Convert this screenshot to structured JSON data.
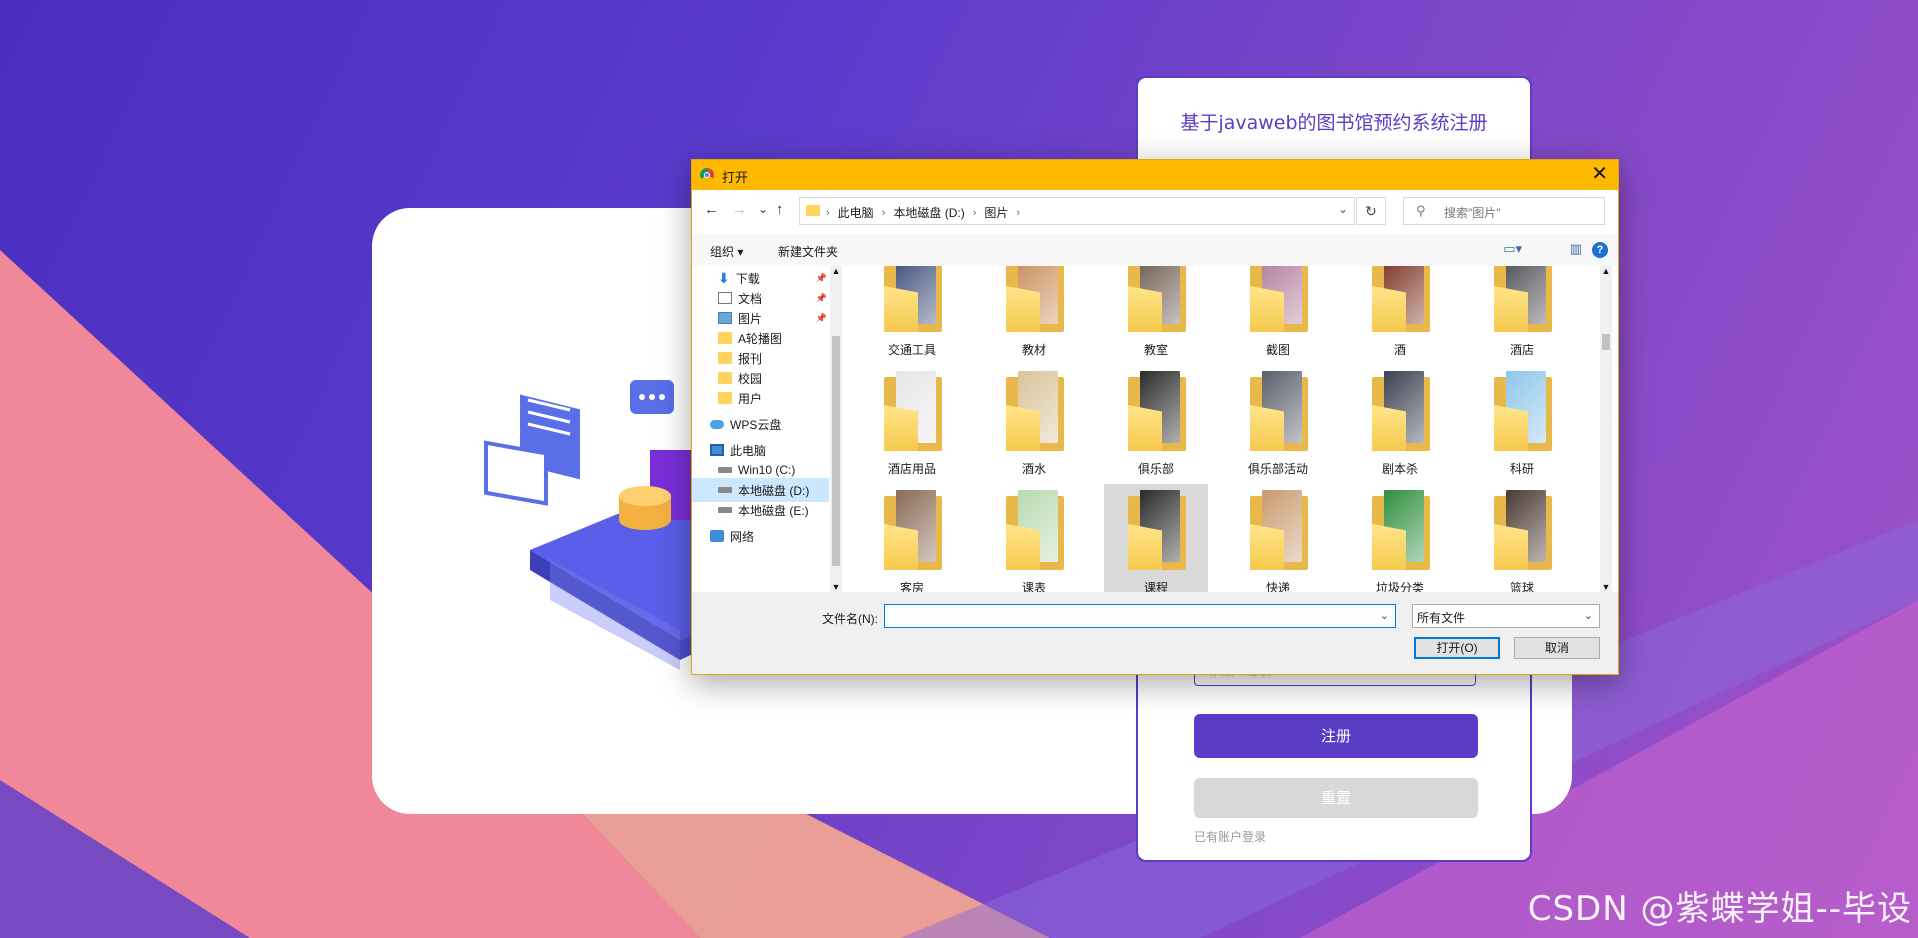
{
  "background": {
    "colors": {
      "purple": "#5a3bcc",
      "pink": "#f0889a",
      "peach": "#f7a98f",
      "accent": "#5b3cc4"
    }
  },
  "registration": {
    "title": "基于javaweb的图书馆预约系统注册",
    "field_placeholder": "请输入班级",
    "submit_label": "注册",
    "reset_label": "重置",
    "login_link": "已有账户登录"
  },
  "dialog": {
    "title": "打开",
    "close": "✕",
    "nav": {
      "back": "←",
      "forward": "→",
      "recent": "⌄",
      "up": "↑",
      "refresh": "↻"
    },
    "breadcrumb": [
      "此电脑",
      "本地磁盘 (D:)",
      "图片"
    ],
    "search_placeholder": "搜索\"图片\"",
    "commands": {
      "organize": "组织 ▾",
      "new_folder": "新建文件夹"
    },
    "nav_items": [
      {
        "label": "下载",
        "icon": "download-icon",
        "pinned": true
      },
      {
        "label": "文档",
        "icon": "document-icon",
        "pinned": true
      },
      {
        "label": "图片",
        "icon": "pictures-icon",
        "pinned": true
      },
      {
        "label": "A轮播图",
        "icon": "folder-icon",
        "pinned": false
      },
      {
        "label": "报刊",
        "icon": "folder-icon",
        "pinned": false
      },
      {
        "label": "校园",
        "icon": "folder-icon",
        "pinned": false
      },
      {
        "label": "用户",
        "icon": "folder-icon",
        "pinned": false
      },
      {
        "label": "WPS云盘",
        "icon": "cloud-icon",
        "pinned": false
      },
      {
        "label": "此电脑",
        "icon": "computer-icon",
        "pinned": false
      },
      {
        "label": "Win10 (C:)",
        "icon": "drive-icon",
        "pinned": false
      },
      {
        "label": "本地磁盘 (D:)",
        "icon": "drive-icon",
        "pinned": false,
        "selected": true
      },
      {
        "label": "本地磁盘 (E:)",
        "icon": "drive-icon",
        "pinned": false
      },
      {
        "label": "网络",
        "icon": "network-icon",
        "pinned": false
      }
    ],
    "folders": [
      {
        "name": "交通工具",
        "tint": "#3a4a78"
      },
      {
        "name": "教材",
        "tint": "#c98a55"
      },
      {
        "name": "教室",
        "tint": "#6b5a4e"
      },
      {
        "name": "截图",
        "tint": "#b07a9a"
      },
      {
        "name": "酒",
        "tint": "#7a2f1e"
      },
      {
        "name": "酒店",
        "tint": "#4a4a52"
      },
      {
        "name": "酒店用品",
        "tint": "#e6e6e6"
      },
      {
        "name": "酒水",
        "tint": "#d8c39a"
      },
      {
        "name": "俱乐部",
        "tint": "#2b2b2b"
      },
      {
        "name": "俱乐部活动",
        "tint": "#5a5f6a"
      },
      {
        "name": "剧本杀",
        "tint": "#3b4150"
      },
      {
        "name": "科研",
        "tint": "#8ec6ea"
      },
      {
        "name": "客房",
        "tint": "#8a6a55"
      },
      {
        "name": "课表",
        "tint": "#b9d9b0"
      },
      {
        "name": "课程",
        "tint": "#2a2a2a",
        "selected": true
      },
      {
        "name": "快递",
        "tint": "#c99a70"
      },
      {
        "name": "垃圾分类",
        "tint": "#2f8f3e"
      },
      {
        "name": "篮球",
        "tint": "#4a3a30"
      }
    ],
    "file_name_label": "文件名(N):",
    "file_name_value": "",
    "file_type": "所有文件",
    "open_label": "打开(O)",
    "cancel_label": "取消"
  },
  "watermark": "CSDN @紫蝶学姐--毕设"
}
